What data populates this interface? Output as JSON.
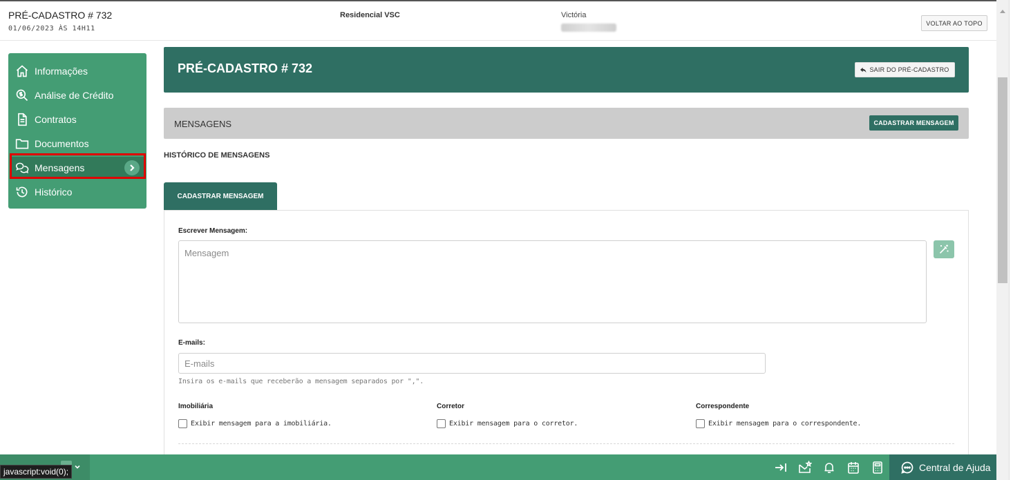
{
  "header": {
    "title": "PRÉ-CADASTRO # 732",
    "date": "01/06/2023 ÀS 14H11",
    "project": "Residencial VSC",
    "user": "Victória",
    "back_to_top": "VOLTAR AO TOPO"
  },
  "sidebar": {
    "items": [
      {
        "label": "Informações",
        "icon": "home-icon"
      },
      {
        "label": "Análise de Crédito",
        "icon": "dollar-search-icon"
      },
      {
        "label": "Contratos",
        "icon": "document-icon"
      },
      {
        "label": "Documentos",
        "icon": "folder-icon"
      },
      {
        "label": "Mensagens",
        "icon": "chat-bubbles-icon",
        "active": true
      },
      {
        "label": "Histórico",
        "icon": "history-icon"
      }
    ]
  },
  "main": {
    "banner_title": "PRÉ-CADASTRO # 732",
    "exit_button": "SAIR DO PRÉ-CADASTRO",
    "section_title": "MENSAGENS",
    "register_button": "CADASTRAR MENSAGEM",
    "history_title": "HISTÓRICO DE MENSAGENS",
    "tab_label": "CADASTRAR MENSAGEM",
    "form": {
      "message_label": "Escrever Mensagem:",
      "message_placeholder": "Mensagem",
      "emails_label": "E-mails:",
      "emails_placeholder": "E-mails",
      "emails_hint": "Insira os e-mails que receberão a mensagem separados por \",\".",
      "checks": [
        {
          "title": "Imobiliária",
          "label": "Exibir mensagem para a imobiliária."
        },
        {
          "title": "Corretor",
          "label": "Exibir mensagem para o corretor."
        },
        {
          "title": "Correspondente",
          "label": "Exibir mensagem para o correspondente."
        }
      ]
    }
  },
  "bottom_bar": {
    "help_label": "Central de Ajuda",
    "status_tip": "javascript:void(0);"
  },
  "colors": {
    "sidebar_green": "#449d74",
    "dark_green": "#2f6f63",
    "section_gray": "#cccccc",
    "highlight_red": "#e00000"
  }
}
